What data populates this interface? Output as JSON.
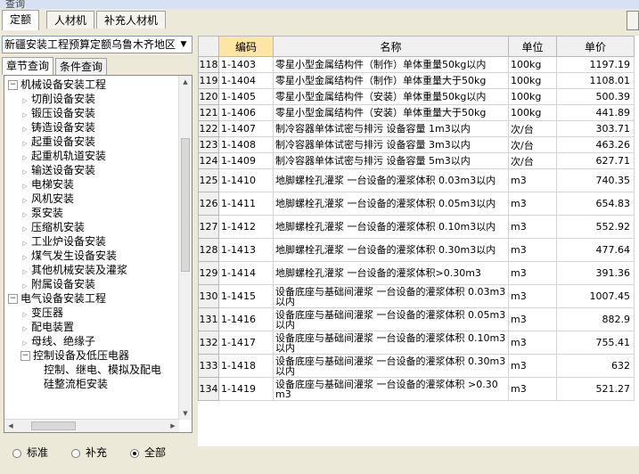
{
  "window": {
    "title": "查询"
  },
  "tabs": [
    {
      "label": "定额"
    },
    {
      "label": "人材机"
    },
    {
      "label": "补充人材机"
    }
  ],
  "region_select": {
    "value": "新疆安装工程预算定额乌鲁木齐地区"
  },
  "subtabs": [
    {
      "label": "章节查询"
    },
    {
      "label": "条件查询"
    }
  ],
  "tree": [
    {
      "label": "机械设备安装工程",
      "level": 0,
      "expanded": true
    },
    {
      "label": "切削设备安装",
      "level": 1
    },
    {
      "label": "锻压设备安装",
      "level": 1
    },
    {
      "label": "铸造设备安装",
      "level": 1
    },
    {
      "label": "起重设备安装",
      "level": 1
    },
    {
      "label": "起重机轨道安装",
      "level": 1
    },
    {
      "label": "输送设备安装",
      "level": 1
    },
    {
      "label": "电梯安装",
      "level": 1
    },
    {
      "label": "风机安装",
      "level": 1
    },
    {
      "label": "泵安装",
      "level": 1
    },
    {
      "label": "压缩机安装",
      "level": 1
    },
    {
      "label": "工业炉设备安装",
      "level": 1
    },
    {
      "label": "煤气发生设备安装",
      "level": 1
    },
    {
      "label": "其他机械安装及灌浆",
      "level": 1
    },
    {
      "label": "附属设备安装",
      "level": 1
    },
    {
      "label": "电气设备安装工程",
      "level": 0,
      "expanded": true
    },
    {
      "label": "变压器",
      "level": 1
    },
    {
      "label": "配电装置",
      "level": 1
    },
    {
      "label": "母线、绝缘子",
      "level": 1
    },
    {
      "label": "控制设备及低压电器",
      "level": 1,
      "expanded": true
    },
    {
      "label": "控制、继电、模拟及配电",
      "level": 2
    },
    {
      "label": "硅整流柜安装",
      "level": 2
    }
  ],
  "filter_radios": [
    {
      "label": "标准",
      "checked": false
    },
    {
      "label": "补充",
      "checked": false
    },
    {
      "label": "全部",
      "checked": true
    }
  ],
  "table": {
    "headers": {
      "code": "编码",
      "name": "名称",
      "unit": "单位",
      "price": "单价"
    },
    "rows": [
      {
        "no": "118",
        "code": "1-1403",
        "name": "零星小型金属结构件（制作）单体重量50kg以内",
        "unit": "100kg",
        "price": "1197.19"
      },
      {
        "no": "119",
        "code": "1-1404",
        "name": "零星小型金属结构件（制作）单体重量大于50kg",
        "unit": "100kg",
        "price": "1108.01"
      },
      {
        "no": "120",
        "code": "1-1405",
        "name": "零星小型金属结构件（安装）单体重量50kg以内",
        "unit": "100kg",
        "price": "500.39"
      },
      {
        "no": "121",
        "code": "1-1406",
        "name": "零星小型金属结构件（安装）单体重量大于50kg",
        "unit": "100kg",
        "price": "441.89"
      },
      {
        "no": "122",
        "code": "1-1407",
        "name": "制冷容器单体试密与排污 设备容量 1m3以内",
        "unit": "次/台",
        "price": "303.71"
      },
      {
        "no": "123",
        "code": "1-1408",
        "name": "制冷容器单体试密与排污 设备容量 3m3以内",
        "unit": "次/台",
        "price": "463.26"
      },
      {
        "no": "124",
        "code": "1-1409",
        "name": "制冷容器单体试密与排污 设备容量 5m3以内",
        "unit": "次/台",
        "price": "627.71"
      },
      {
        "no": "125",
        "code": "1-1410",
        "name": "地脚螺栓孔灌浆 一台设备的灌浆体积 0.03m3以内",
        "unit": "m3",
        "price": "740.35"
      },
      {
        "no": "126",
        "code": "1-1411",
        "name": "地脚螺栓孔灌浆 一台设备的灌浆体积 0.05m3以内",
        "unit": "m3",
        "price": "654.83"
      },
      {
        "no": "127",
        "code": "1-1412",
        "name": "地脚螺栓孔灌浆 一台设备的灌浆体积 0.10m3以内",
        "unit": "m3",
        "price": "552.92"
      },
      {
        "no": "128",
        "code": "1-1413",
        "name": "地脚螺栓孔灌浆 一台设备的灌浆体积 0.30m3以内",
        "unit": "m3",
        "price": "477.64"
      },
      {
        "no": "129",
        "code": "1-1414",
        "name": "地脚螺栓孔灌浆 一台设备的灌浆体积>0.30m3",
        "unit": "m3",
        "price": "391.36"
      },
      {
        "no": "130",
        "code": "1-1415",
        "name": "设备底座与基础间灌浆 一台设备的灌浆体积 0.03m3以内",
        "unit": "m3",
        "price": "1007.45"
      },
      {
        "no": "131",
        "code": "1-1416",
        "name": "设备底座与基础间灌浆 一台设备的灌浆体积 0.05m3以内",
        "unit": "m3",
        "price": "882.9"
      },
      {
        "no": "132",
        "code": "1-1417",
        "name": "设备底座与基础间灌浆 一台设备的灌浆体积 0.10m3以内",
        "unit": "m3",
        "price": "755.41"
      },
      {
        "no": "133",
        "code": "1-1418",
        "name": "设备底座与基础间灌浆 一台设备的灌浆体积 0.30m3以内",
        "unit": "m3",
        "price": "632"
      },
      {
        "no": "134",
        "code": "1-1419",
        "name": "设备底座与基础间灌浆 一台设备的灌浆体积 >0.30m3",
        "unit": "m3",
        "price": "521.27"
      }
    ]
  }
}
